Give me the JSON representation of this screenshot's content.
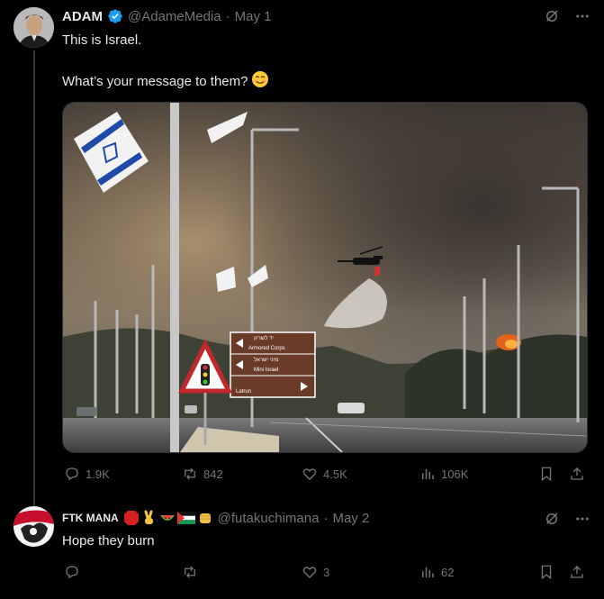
{
  "post1": {
    "name": "ADAM",
    "handle": "@AdameMedia",
    "dot": "·",
    "date": "May 1",
    "line1": "This is Israel.",
    "line2": "What’s your message to them?",
    "stats": {
      "replies": "1.9K",
      "reposts": "842",
      "likes": "4.5K",
      "views": "106K"
    },
    "image_signs": {
      "line1": "Armored Corps",
      "line2": "Mini Israel",
      "line3": "Latrun",
      "hebrew1": "יד לשריון",
      "hebrew2": "מיני ישראל"
    }
  },
  "post2": {
    "name": "FTK MANA",
    "handle": "@futakuchimana",
    "dot": "·",
    "date": "May 2",
    "text": "Hope they burn",
    "stats": {
      "replies": "",
      "reposts": "",
      "likes": "3",
      "views": "62"
    }
  },
  "icons": [
    "grok-icon",
    "more-icon",
    "reply-icon",
    "repost-icon",
    "like-icon",
    "views-icon",
    "bookmark-icon",
    "share-icon",
    "verified-icon"
  ],
  "colors": {
    "background": "#000000",
    "text": "#e7e9ea",
    "muted": "#71767b",
    "verified": "#1d9bf0",
    "divider": "#2f3336"
  }
}
